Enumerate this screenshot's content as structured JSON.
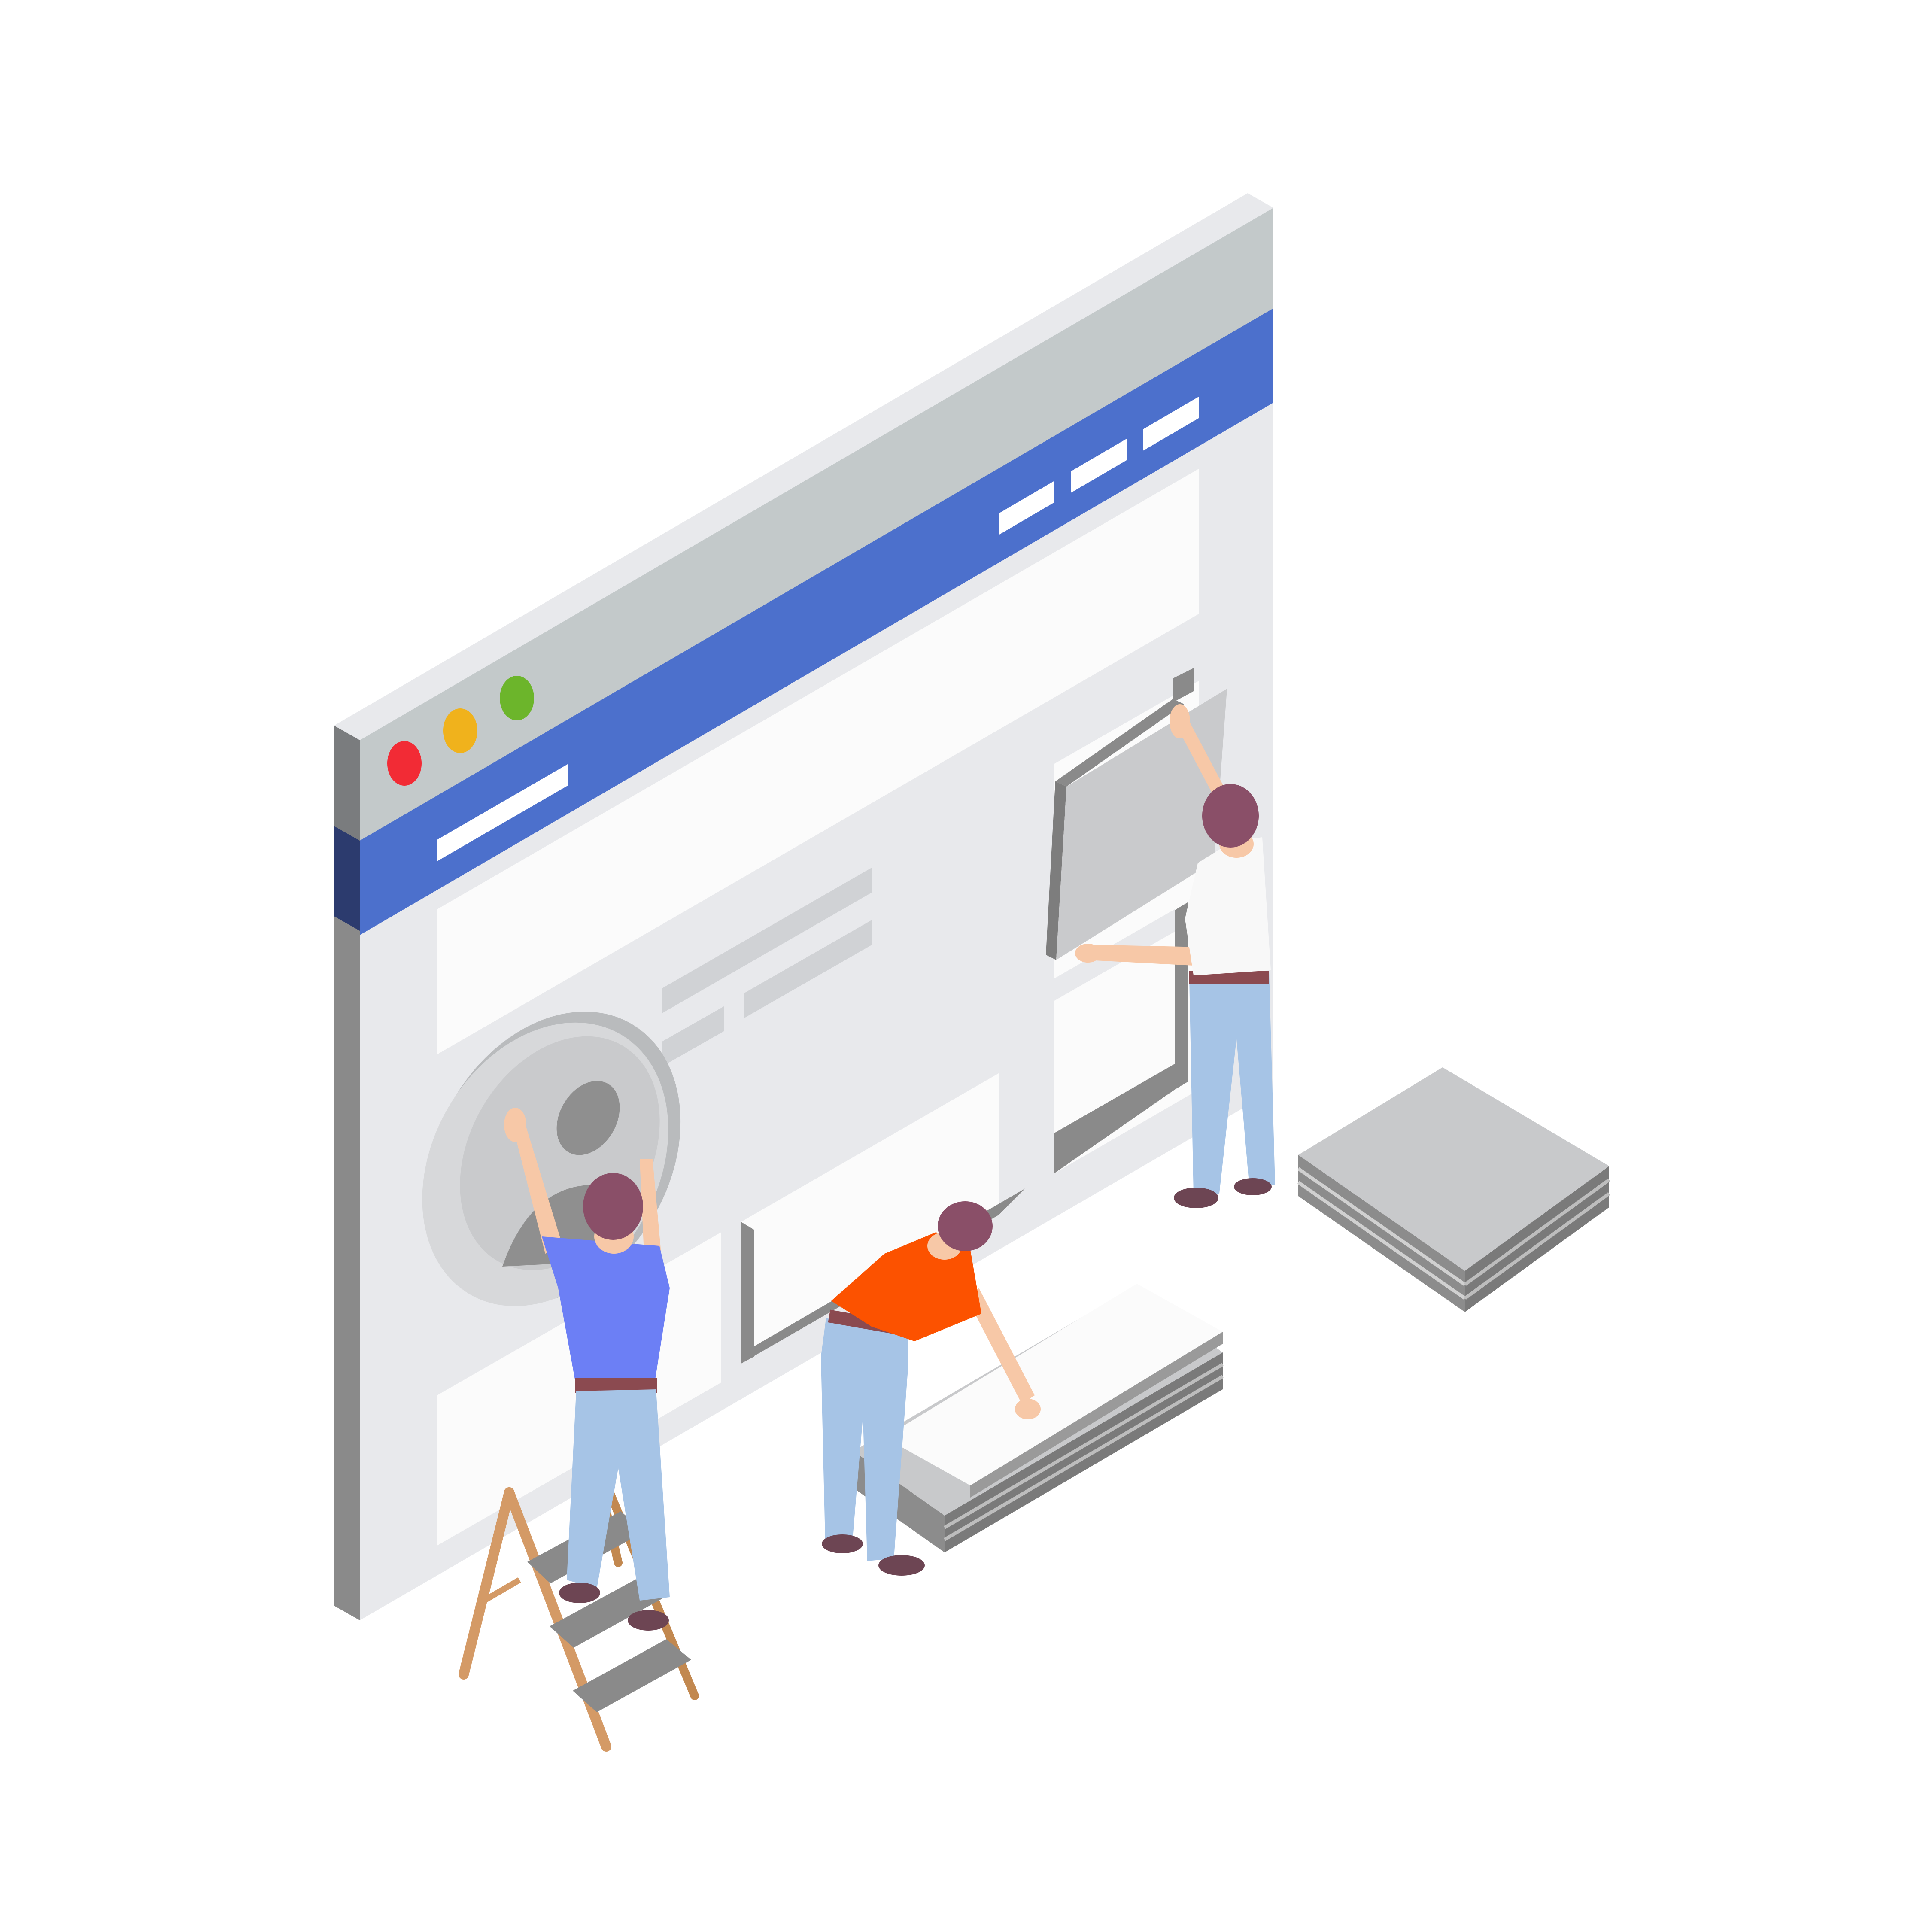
{
  "scene": {
    "description_free": true,
    "colors": {
      "background": "#ffffff",
      "frame_top": "#e8e9ec",
      "frame_side": "#8a8a8a",
      "frame_side_dark": "#2c3b6e",
      "title_bar": "#c3c9ca",
      "nav_bar": "#4c70cc",
      "content": "#e8e9ec",
      "panel": "#fbfbfb",
      "placeholder": "#d0d2d5",
      "dot_red": "#f22b35",
      "dot_yellow": "#f0b21c",
      "dot_green": "#6cb52b",
      "stack_top": "#c8c9cb",
      "stack_side": "#8c8c8c",
      "shirt_blue": "#6c7ff5",
      "shirt_orange": "#fc5200",
      "shirt_white": "#f8f8f8",
      "jeans": "#a6c4e6",
      "hair": "#8a4f68",
      "skin": "#f7c8a7",
      "ladder": "#d49a66",
      "shoe": "#6d4553"
    },
    "window_controls": [
      "close-dot",
      "minimize-dot",
      "maximize-dot"
    ],
    "icons": [
      "user-avatar-icon",
      "window-panel-icon",
      "ladder-icon",
      "panel-stack-icon"
    ]
  }
}
